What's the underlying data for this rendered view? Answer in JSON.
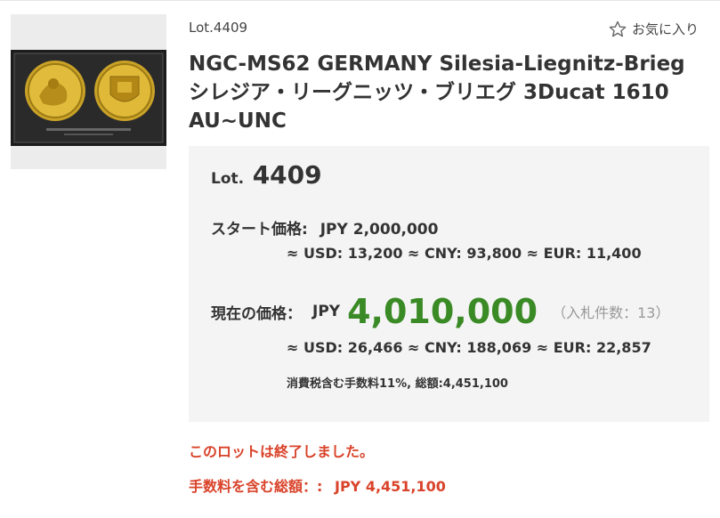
{
  "lot_header": {
    "lot_label": "Lot.4409",
    "favorite_label": "お気に入り",
    "favorite_icon": "star-outline-icon"
  },
  "title": "NGC-MS62 GERMANY Silesia-Liegnitz-Brieg シレジア・リーグニッツ・ブリエグ 3Ducat 1610 AU~UNC",
  "image": {
    "description_icon": "coin-photo"
  },
  "price_box": {
    "lot_word": "Lot.",
    "lot_number": "4409",
    "start_label": "スタート価格:",
    "start_value": "JPY 2,000,000",
    "start_conversion": "≈ USD: 13,200 ≈ CNY: 93,800 ≈ EUR: 11,400",
    "current_label": "現在の価格：",
    "current_currency": "JPY",
    "current_amount": "4,010,000",
    "bid_count": "（入札件数：13）",
    "current_conversion": "≈ USD: 26,466 ≈ CNY: 188,069 ≈ EUR: 22,857",
    "tax_note": "消費税含む手数料11%, 総額:4,451,100"
  },
  "status": {
    "ended_message": "このロットは終了しました。",
    "total_label": "手数料を含む総額：:",
    "total_value": "JPY 4,451,100"
  },
  "colors": {
    "current_price": "#3a8a25",
    "status_red": "#d9432a",
    "box_bg": "#f4f4f4"
  }
}
